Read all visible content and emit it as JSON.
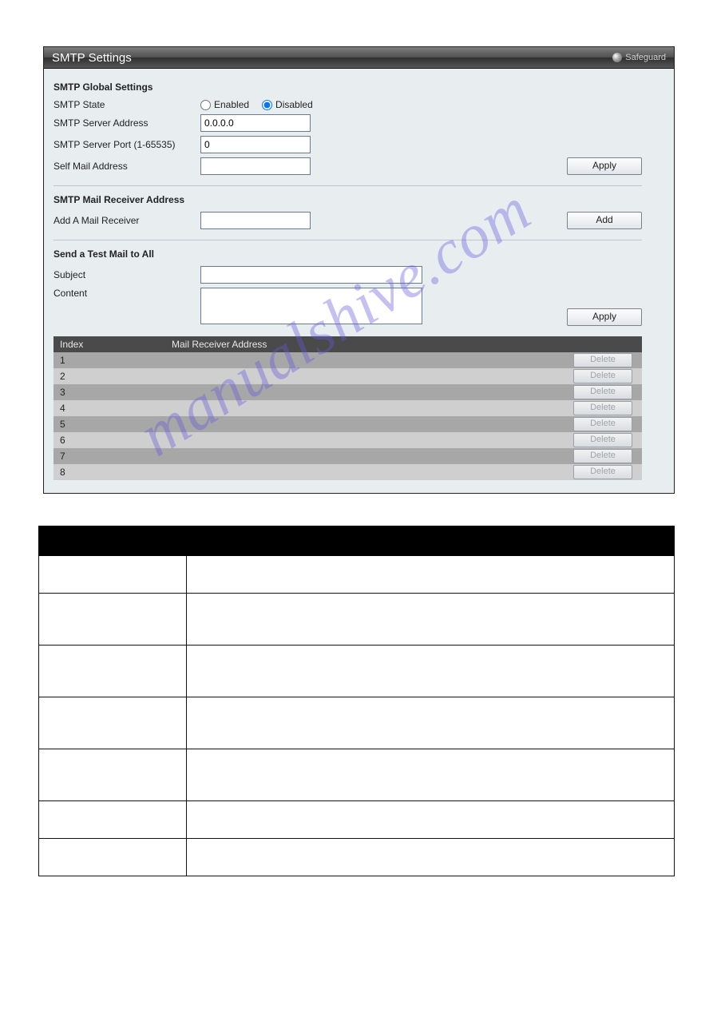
{
  "watermark": "manualshive.com",
  "title_bar": {
    "title": "SMTP Settings",
    "safeguard_label": "Safeguard"
  },
  "global": {
    "section_title": "SMTP Global Settings",
    "state_label": "SMTP State",
    "state_options": {
      "enabled": "Enabled",
      "disabled": "Disabled"
    },
    "state_selected": "disabled",
    "server_addr_label": "SMTP Server Address",
    "server_addr_value": "0.0.0.0",
    "server_port_label": "SMTP Server Port (1-65535)",
    "server_port_value": "0",
    "self_mail_label": "Self Mail Address",
    "self_mail_value": "",
    "apply_label": "Apply"
  },
  "receiver": {
    "section_title": "SMTP Mail Receiver Address",
    "add_label": "Add A Mail Receiver",
    "add_value": "",
    "add_button": "Add"
  },
  "test": {
    "section_title": "Send a Test Mail to All",
    "subject_label": "Subject",
    "subject_value": "",
    "content_label": "Content",
    "content_value": "",
    "apply_label": "Apply"
  },
  "table": {
    "col_index": "Index",
    "col_addr": "Mail Receiver Address",
    "delete_label": "Delete",
    "rows": [
      {
        "index": "1",
        "addr": ""
      },
      {
        "index": "2",
        "addr": ""
      },
      {
        "index": "3",
        "addr": ""
      },
      {
        "index": "4",
        "addr": ""
      },
      {
        "index": "5",
        "addr": ""
      },
      {
        "index": "6",
        "addr": ""
      },
      {
        "index": "7",
        "addr": ""
      },
      {
        "index": "8",
        "addr": ""
      }
    ]
  },
  "doc_table": {
    "header_a": "",
    "header_b": "",
    "rows": [
      {
        "a": "",
        "b": "",
        "tall": false
      },
      {
        "a": "",
        "b": "",
        "tall": true
      },
      {
        "a": "",
        "b": "",
        "tall": true
      },
      {
        "a": "",
        "b": "",
        "tall": true
      },
      {
        "a": "",
        "b": "",
        "tall": true
      },
      {
        "a": "",
        "b": "",
        "tall": false
      },
      {
        "a": "",
        "b": "",
        "tall": false
      }
    ]
  }
}
